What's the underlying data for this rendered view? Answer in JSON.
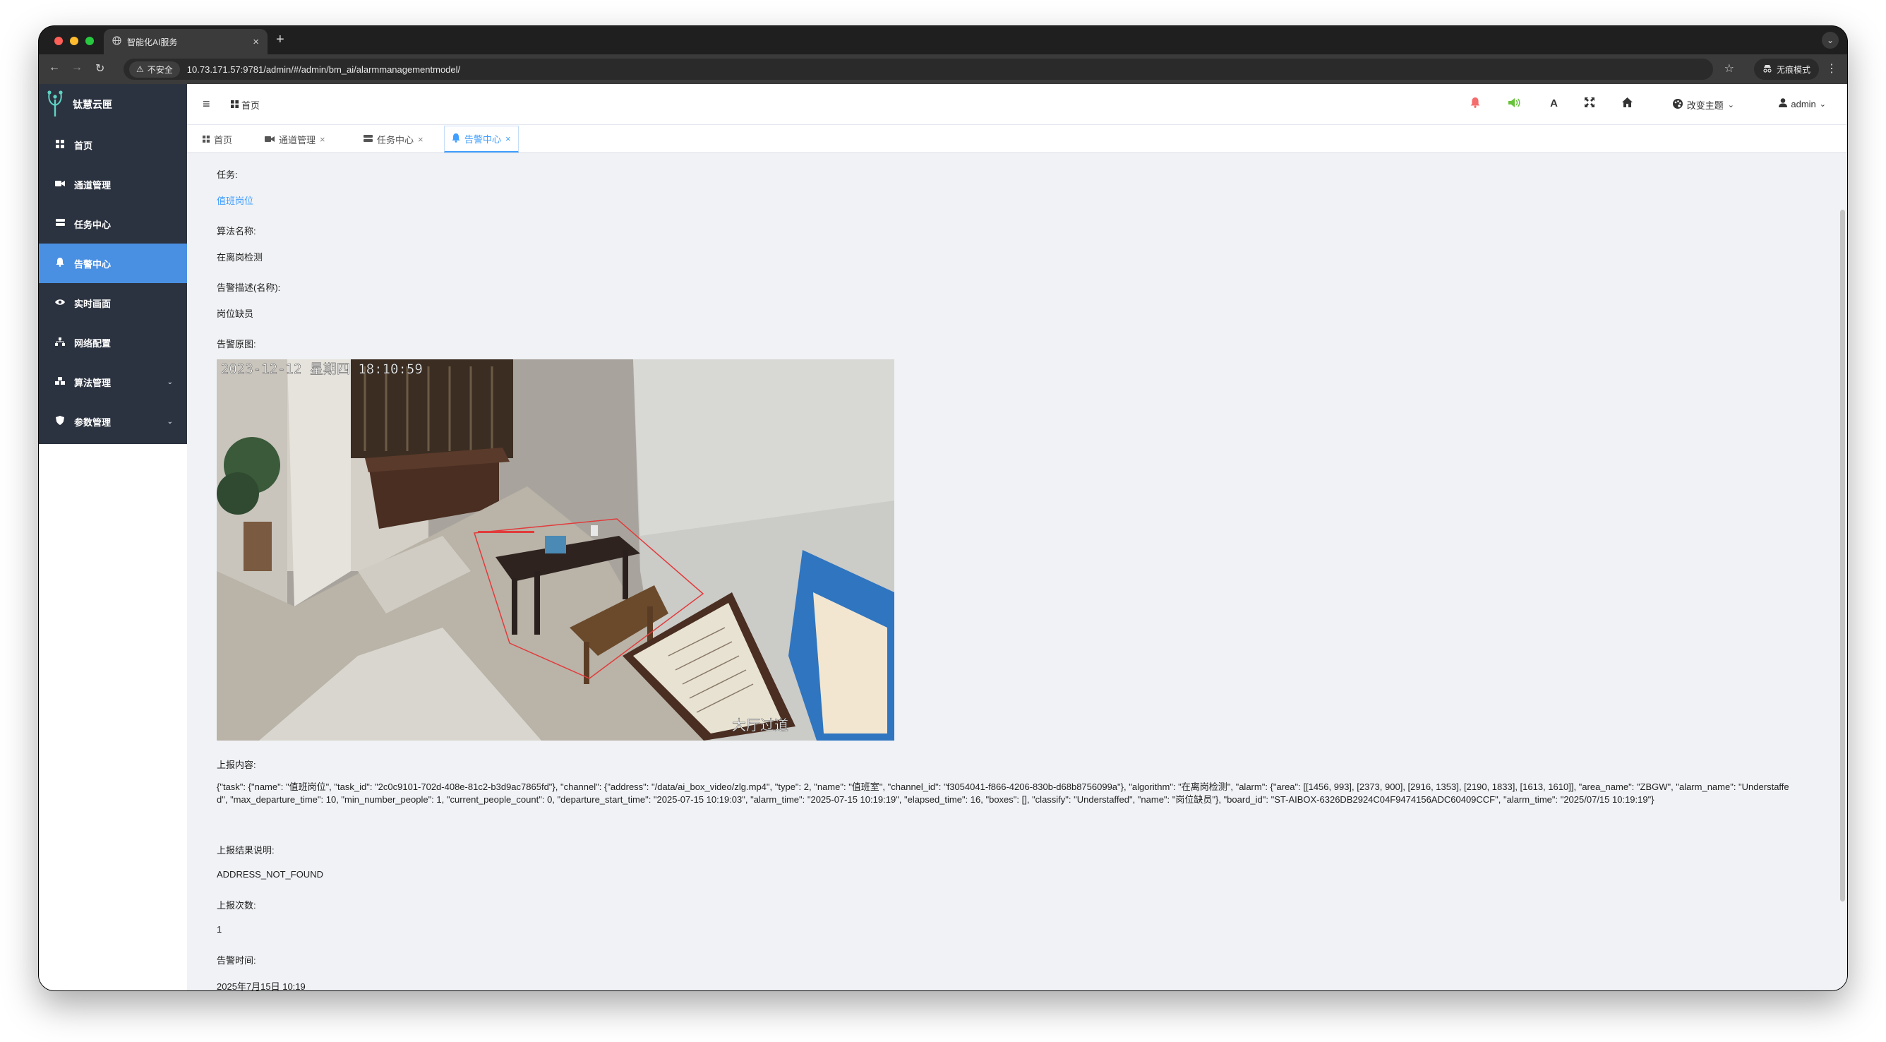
{
  "browser": {
    "tab_title": "智能化AI服务",
    "tab_close": "×",
    "new_tab": "+",
    "insecure_label": "不安全",
    "url": "10.73.171.57:9781/admin/#/admin/bm_ai/alarmmanagementmodel/",
    "incognito_label": "无痕模式"
  },
  "app": {
    "brand": "钛慧云匣",
    "sidebar": [
      {
        "label": "首页",
        "icon": "grid-icon"
      },
      {
        "label": "通道管理",
        "icon": "camera-icon"
      },
      {
        "label": "任务中心",
        "icon": "server-icon"
      },
      {
        "label": "告警中心",
        "icon": "bell-icon",
        "active": true
      },
      {
        "label": "实时画面",
        "icon": "eye-icon"
      },
      {
        "label": "网络配置",
        "icon": "network-icon"
      },
      {
        "label": "算法管理",
        "icon": "cubes-icon",
        "expandable": true
      },
      {
        "label": "参数管理",
        "icon": "shield-icon",
        "expandable": true
      }
    ],
    "header": {
      "breadcrumb": "首页",
      "theme_label": "改变主题",
      "user": "admin"
    },
    "tabs": [
      {
        "label": "首页",
        "closable": false
      },
      {
        "label": "通道管理",
        "closable": true
      },
      {
        "label": "任务中心",
        "closable": true
      },
      {
        "label": "告警中心",
        "closable": true,
        "active": true
      }
    ]
  },
  "detail": {
    "task_label": "任务:",
    "task_value": "值班岗位",
    "algo_label": "算法名称:",
    "algo_value": "在离岗检测",
    "desc_label": "告警描述(名称):",
    "desc_value": "岗位缺员",
    "image_label": "告警原图:",
    "image_timestamp": "2023-12-12 星期四 18:10:59",
    "image_caption": "大厅过道",
    "report_label": "上报内容:",
    "report_value": "{\"task\": {\"name\": \"值班岗位\", \"task_id\": \"2c0c9101-702d-408e-81c2-b3d9ac7865fd\"}, \"channel\": {\"address\": \"/data/ai_box_video/zlg.mp4\", \"type\": 2, \"name\": \"值班室\", \"channel_id\": \"f3054041-f866-4206-830b-d68b8756099a\"}, \"algorithm\": \"在离岗检测\", \"alarm\": {\"area\": [[1456, 993], [2373, 900], [2916, 1353], [2190, 1833], [1613, 1610]], \"area_name\": \"ZBGW\", \"alarm_name\": \"Understaffed\", \"max_departure_time\": 10, \"min_number_people\": 1, \"current_people_count\": 0, \"departure_start_time\": \"2025-07-15 10:19:03\", \"alarm_time\": \"2025-07-15 10:19:19\", \"elapsed_time\": 16, \"boxes\": [], \"classify\": \"Understaffed\", \"name\": \"岗位缺员\"}, \"board_id\": \"ST-AIBOX-6326DB2924C04F9474156ADC60409CCF\", \"alarm_time\": \"2025/07/15 10:19:19\"}",
    "result_label": "上报结果说明:",
    "result_value": "ADDRESS_NOT_FOUND",
    "count_label": "上报次数:",
    "count_value": "1",
    "time_label": "告警时间:",
    "time_value": "2025年7月15日 10:19"
  }
}
